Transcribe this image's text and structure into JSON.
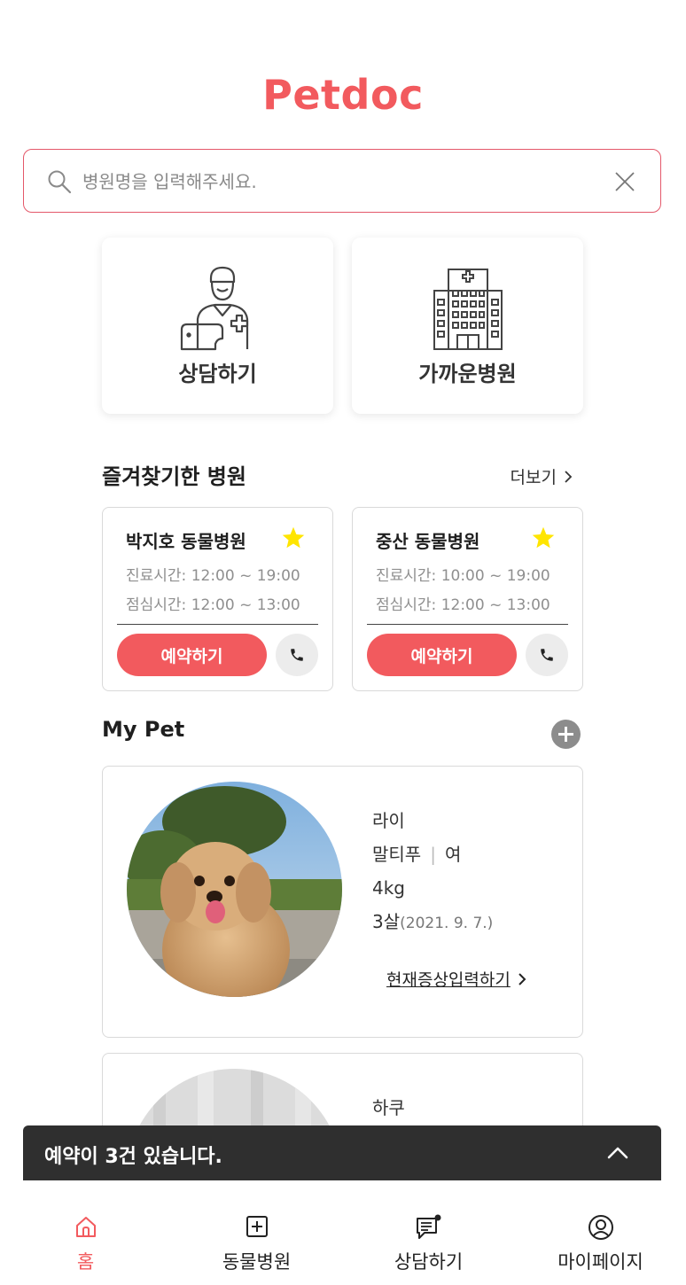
{
  "app": {
    "logo": "Petdoc"
  },
  "search": {
    "placeholder": "병원명을 입력해주세요."
  },
  "quick_actions": [
    {
      "label": "상담하기",
      "icon": "vet-consult-icon"
    },
    {
      "label": "가까운병원",
      "icon": "hospital-building-icon"
    }
  ],
  "favorites": {
    "title": "즐겨찾기한 병원",
    "more_label": "더보기",
    "items": [
      {
        "name": "박지호 동물병원",
        "hours": "진료시간: 12:00 ~ 19:00",
        "lunch": "점심시간: 12:00 ~ 13:00",
        "book_label": "예약하기"
      },
      {
        "name": "중산 동물병원",
        "hours": "진료시간: 10:00 ~ 19:00",
        "lunch": "점심시간: 12:00 ~ 13:00",
        "book_label": "예약하기"
      }
    ]
  },
  "my_pet": {
    "title": "My Pet",
    "pets": [
      {
        "name": "라이",
        "breed": "말티푸",
        "sex": "여",
        "weight": "4kg",
        "age": "3살",
        "birth": "(2021. 9. 7.)",
        "symptom_link": "현재증상입력하기"
      },
      {
        "name": "하쿠"
      }
    ]
  },
  "reservation_banner": {
    "text": "예약이 3건 있습니다."
  },
  "tabbar": {
    "items": [
      {
        "label": "홈",
        "icon": "home-icon",
        "active": true
      },
      {
        "label": "동물병원",
        "icon": "hospital-plus-icon"
      },
      {
        "label": "상담하기",
        "icon": "chat-icon"
      },
      {
        "label": "마이페이지",
        "icon": "user-icon"
      }
    ]
  },
  "colors": {
    "accent": "#F25A5E",
    "star": "#FFE500",
    "banner": "#2F2F2F"
  }
}
